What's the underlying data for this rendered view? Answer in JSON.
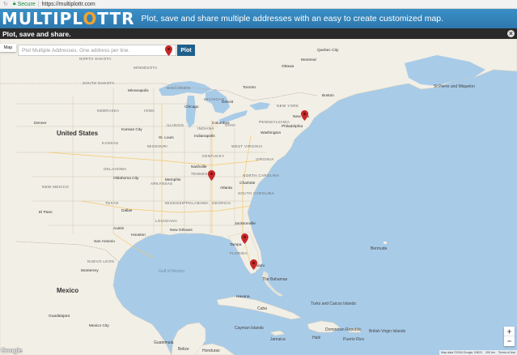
{
  "browser": {
    "secure_label": "Secure",
    "url": "https://multiplottr.com"
  },
  "header": {
    "logo_main": "MULTIPL",
    "logo_o": "O",
    "logo_end": "TTR",
    "tagline": "Plot, save and share multiple addresses with an easy to create customized map.",
    "accent_color": "#2d78ad",
    "logo_accent_color": "#f2a330"
  },
  "subbar": {
    "title": "Plot, save and share.",
    "close_icon": "close-icon"
  },
  "map": {
    "type_button": "Map",
    "input_placeholder": "Plot Multiple Addresses. One address per line.",
    "plot_button": "Plot",
    "marker_color": "#c62828",
    "countries": {
      "us": "United States",
      "mexico": "Mexico"
    },
    "states": {
      "nd": "NORTH DAKOTA",
      "sd": "SOUTH DAKOTA",
      "mn": "MINNESOTA",
      "wi": "WISCONSIN",
      "mi": "MICHIGAN",
      "ne": "NEBRASKA",
      "ia": "IOWA",
      "il": "ILLINOIS",
      "in": "INDIANA",
      "oh": "OHIO",
      "pa": "PENNSYLVANIA",
      "ny": "NEW YORK",
      "ks": "KANSAS",
      "mo": "MISSOURI",
      "ky": "KENTUCKY",
      "wv": "WEST VIRGINIA",
      "va": "VIRGINIA",
      "ok": "OKLAHOMA",
      "ar": "ARKANSAS",
      "tn": "TENNESSEE",
      "nc": "NORTH CAROLINA",
      "sc": "SOUTH CAROLINA",
      "ga": "GEORGIA",
      "al": "ALABAMA",
      "ms": "MISSISSIPPI",
      "la": "LOUISIANA",
      "tx": "TEXAS",
      "nm": "NEW MEXICO",
      "fl": "FLORIDA",
      "nl": "NUEVO LEON"
    },
    "cities": {
      "denver": "Denver",
      "chicago": "Chicago",
      "detroit": "Detroit",
      "toronto": "Toronto",
      "ottawa": "Ottawa",
      "montreal": "Montreal",
      "quebec": "Quebec City",
      "boston": "Boston",
      "newyork": "New York",
      "philadelphia": "Philadelphia",
      "washington": "Washington",
      "kansascity": "Kansas City",
      "stlouis": "St. Louis",
      "nashville": "Nashville",
      "atlanta": "Atlanta",
      "charlotte": "Charlotte",
      "memphis": "Memphis",
      "dallas": "Dallas",
      "houston": "Houston",
      "sanantonio": "San Antonio",
      "austin": "Austin",
      "elpaso": "El Paso",
      "neworleans": "New Orleans",
      "jacksonville": "Jacksonville",
      "tampa": "Tampa",
      "miami": "Miami",
      "monterrey": "Monterrey",
      "mexicocity": "Mexico City",
      "havana": "Havana",
      "guadalajara": "Guadalajara",
      "minneapolis": "Minneapolis",
      "indianapolis": "Indianapolis",
      "columbus": "Columbus",
      "oklahomacity": "Oklahoma City"
    },
    "water": {
      "gulf": "Gulf of Mexico",
      "bermuda": "Bermuda",
      "bahamas": "The Bahamas",
      "cuba": "Cuba",
      "stpierre": "St Pierre and Miquelon",
      "turks": "Turks and Caicos Islands",
      "caymans": "Cayman Islands",
      "jamaica": "Jamaica",
      "haiti": "Haiti",
      "dominican": "Dominican Republic",
      "puertorico": "Puerto Rico",
      "virgin": "British Virgin Islands",
      "belize": "Belize",
      "guatemala": "Guatemala",
      "honduras": "Honduras"
    },
    "zoom_in": "+",
    "zoom_out": "−",
    "google_logo": "Google",
    "attribution": {
      "data": "Map data ©2018 Google, INEGI",
      "scale": "200 km",
      "terms": "Terms of Use"
    }
  }
}
